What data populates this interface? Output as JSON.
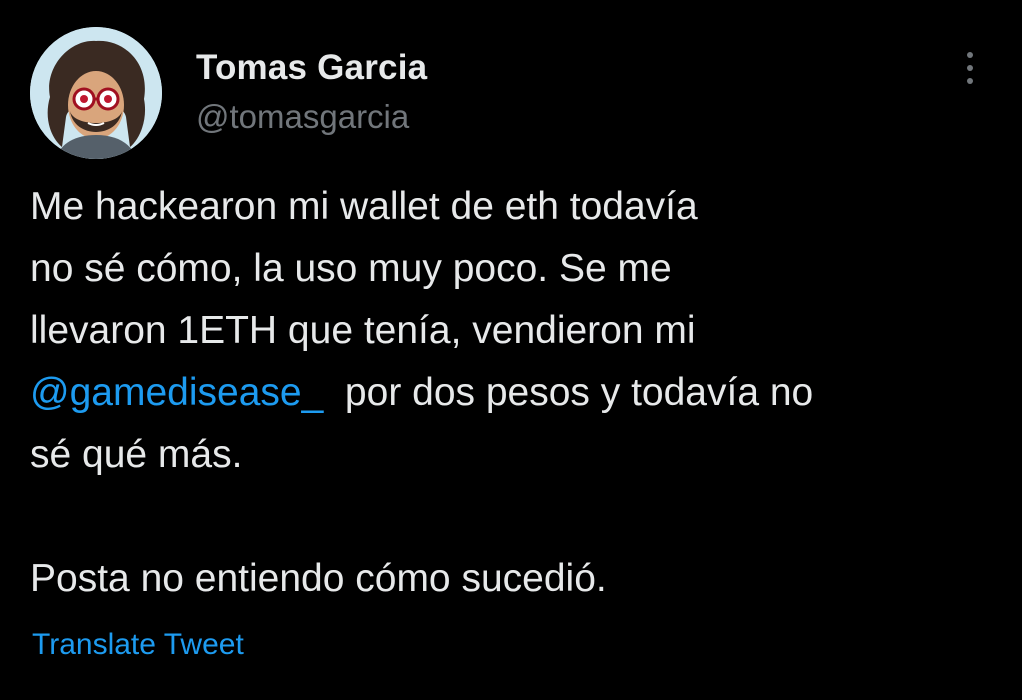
{
  "author": {
    "display_name": "Tomas Garcia",
    "handle": "@tomasgarcia",
    "avatar_icon": "illustrated-portrait-avatar"
  },
  "more_icon": "vertical-ellipsis-icon",
  "tweet": {
    "line1": "Me hackearon mi wallet de eth todavía",
    "line2": "no sé cómo, la uso muy poco. Se me",
    "line3": "llevaron 1ETH que tenía, vendieron mi",
    "mention": "@gamedisease_",
    "line4_rest": "  por dos pesos y todavía no",
    "line5": "sé qué más.",
    "line6": "Posta no entiendo cómo sucedió."
  },
  "translate_label": "Translate Tweet",
  "colors": {
    "background": "#000000",
    "text_primary": "#e7e9ea",
    "text_secondary": "#71767b",
    "link": "#1d9bf0"
  }
}
